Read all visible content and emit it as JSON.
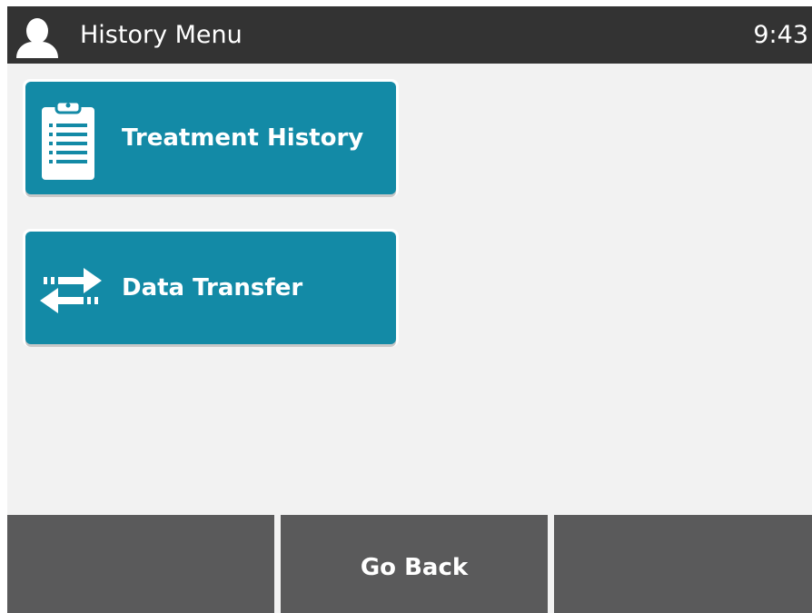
{
  "header": {
    "title": "History Menu",
    "clock": "9:43",
    "user_icon": "user-icon"
  },
  "menu": {
    "items": [
      {
        "label": "Treatment History",
        "icon": "clipboard-icon"
      },
      {
        "label": "Data Transfer",
        "icon": "transfer-arrows-icon"
      }
    ]
  },
  "footer": {
    "left_label": "",
    "center_label": "Go Back",
    "right_label": ""
  },
  "colors": {
    "header_bg": "#333333",
    "screen_bg": "#f2f2f2",
    "button_teal": "#138aa6",
    "footer_bg": "#5a5a5b",
    "text_white": "#ffffff"
  }
}
